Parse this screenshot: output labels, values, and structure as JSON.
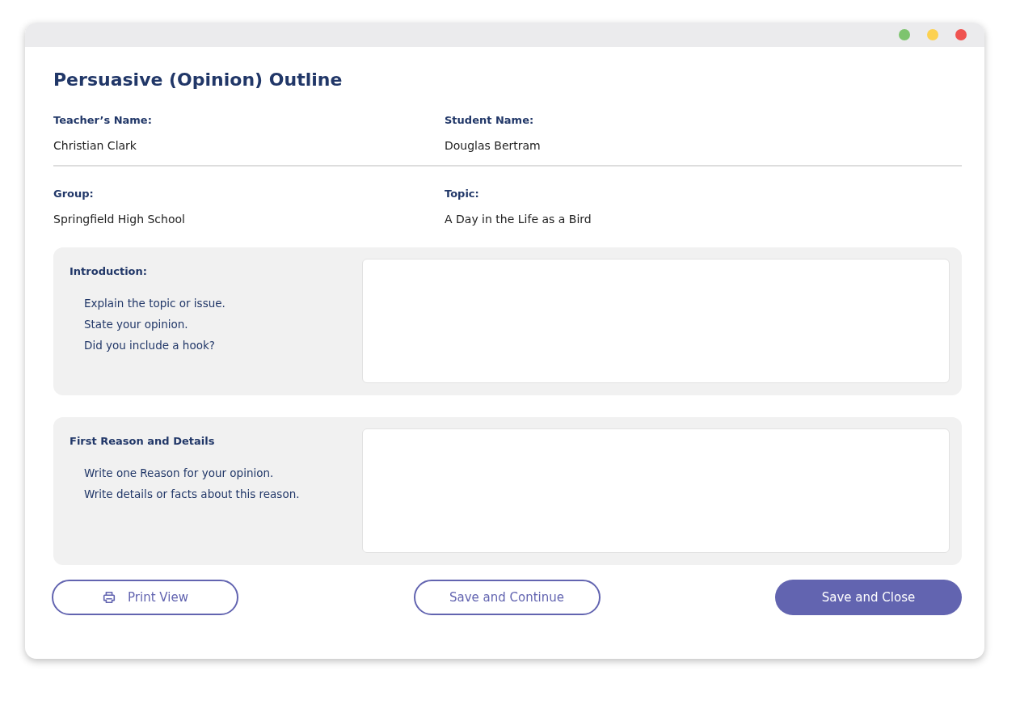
{
  "window": {
    "controls": [
      {
        "color": "#7dc46e"
      },
      {
        "color": "#fcd150"
      },
      {
        "color": "#ef5350"
      }
    ]
  },
  "title": "Persuasive (Opinion) Outline",
  "fields_top": [
    {
      "label": "Teacher’s Name:",
      "value": "Christian Clark"
    },
    {
      "label": "Student Name:",
      "value": "Douglas Bertram"
    }
  ],
  "fields_bottom": [
    {
      "label": "Group:",
      "value": "Springfield High School"
    },
    {
      "label": "Topic:",
      "value": "A Day in the Life as a Bird"
    }
  ],
  "sections": [
    {
      "heading": "Introduction:",
      "prompts": [
        "Explain the topic or issue.",
        "State your opinion.",
        "Did you include a hook?"
      ]
    },
    {
      "heading": "First Reason and Details",
      "prompts": [
        "Write one Reason for your opinion.",
        "Write details or facts about this reason."
      ]
    }
  ],
  "buttons": [
    {
      "kind": "outline",
      "label": "Print View",
      "icon": true
    },
    {
      "kind": "outline",
      "label": "Save and Continue"
    },
    {
      "kind": "filled",
      "label": "Save and Close"
    }
  ]
}
